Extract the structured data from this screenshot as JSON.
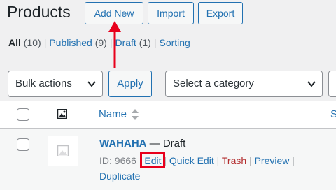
{
  "header": {
    "title": "Products",
    "add_new": "Add New",
    "import": "Import",
    "export": "Export"
  },
  "views": [
    {
      "label": "All",
      "count": "(10)"
    },
    {
      "label": "Published",
      "count": "(9)"
    },
    {
      "label": "Draft",
      "count": "(1)"
    },
    {
      "label": "Sorting",
      "count": ""
    }
  ],
  "filters": {
    "bulk_actions": "Bulk actions",
    "apply": "Apply",
    "category_placeholder": "Select a category"
  },
  "table": {
    "col_name": "Name",
    "col_next": "S"
  },
  "product": {
    "name": "WAHAHA",
    "state": "— Draft",
    "id_label": "ID: 9666",
    "actions": {
      "edit": "Edit",
      "quick_edit": "Quick Edit",
      "trash": "Trash",
      "preview": "Preview",
      "duplicate": "Duplicate"
    }
  },
  "colors": {
    "accent": "#2271b1",
    "annotation": "#e8001c",
    "trash": "#b32d2e"
  }
}
